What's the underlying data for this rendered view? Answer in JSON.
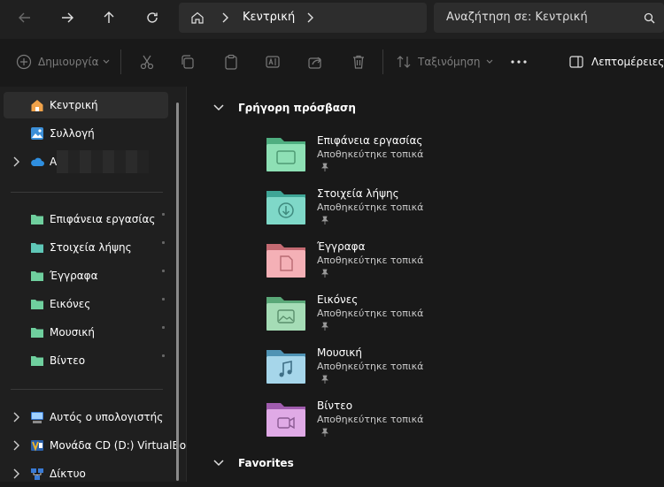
{
  "address": {
    "breadcrumb": "Κεντρική",
    "search_placeholder": "Αναζήτηση σε: Κεντρική"
  },
  "toolbar": {
    "new_label": "Δημιουργία",
    "sort_label": "Ταξινόμηση",
    "details_label": "Λεπτομέρειες"
  },
  "sidebar": {
    "top": [
      {
        "label": "Κεντρική",
        "icon": "home-icon",
        "selected": true
      },
      {
        "label": "Συλλογή",
        "icon": "gallery-icon"
      },
      {
        "label": "A",
        "icon": "onedrive-cloud-icon"
      }
    ],
    "pinned": [
      {
        "label": "Επιφάνεια εργασίας",
        "icon": "desktop-folder-icon"
      },
      {
        "label": "Στοιχεία λήψης",
        "icon": "downloads-folder-icon"
      },
      {
        "label": "Έγγραφα",
        "icon": "documents-folder-icon"
      },
      {
        "label": "Εικόνες",
        "icon": "pictures-folder-icon"
      },
      {
        "label": "Μουσική",
        "icon": "music-folder-icon"
      },
      {
        "label": "Βίντεο",
        "icon": "videos-folder-icon"
      }
    ],
    "devices": [
      {
        "label": "Αυτός ο υπολογιστής",
        "icon": "computer-icon"
      },
      {
        "label": "Μονάδα CD (D:) VirtualBo",
        "icon": "cd-drive-icon"
      },
      {
        "label": "Δίκτυο",
        "icon": "network-icon"
      }
    ]
  },
  "main": {
    "quick_access_title": "Γρήγορη πρόσβαση",
    "favorites_title": "Favorites",
    "folders": [
      {
        "name": "Επιφάνεια εργασίας",
        "subtitle": "Αποθηκεύτηκε τοπικά",
        "color": "#6fcf9e"
      },
      {
        "name": "Στοιχεία λήψης",
        "subtitle": "Αποθηκεύτηκε τοπικά",
        "color": "#5fc7b7"
      },
      {
        "name": "Έγγραφα",
        "subtitle": "Αποθηκεύτηκε τοπικά",
        "color": "#e58f96"
      },
      {
        "name": "Εικόνες",
        "subtitle": "Αποθηκεύτηκε τοπικά",
        "color": "#7fc99a"
      },
      {
        "name": "Μουσική",
        "subtitle": "Αποθηκεύτηκε τοπικά",
        "color": "#6eb8d6"
      },
      {
        "name": "Βίντεο",
        "subtitle": "Αποθηκεύτηκε τοπικά",
        "color": "#c97fd0"
      }
    ]
  },
  "colors": {
    "accent": "#4cc2ff",
    "background": "#191919",
    "sidebar": "#1f1f1f"
  }
}
